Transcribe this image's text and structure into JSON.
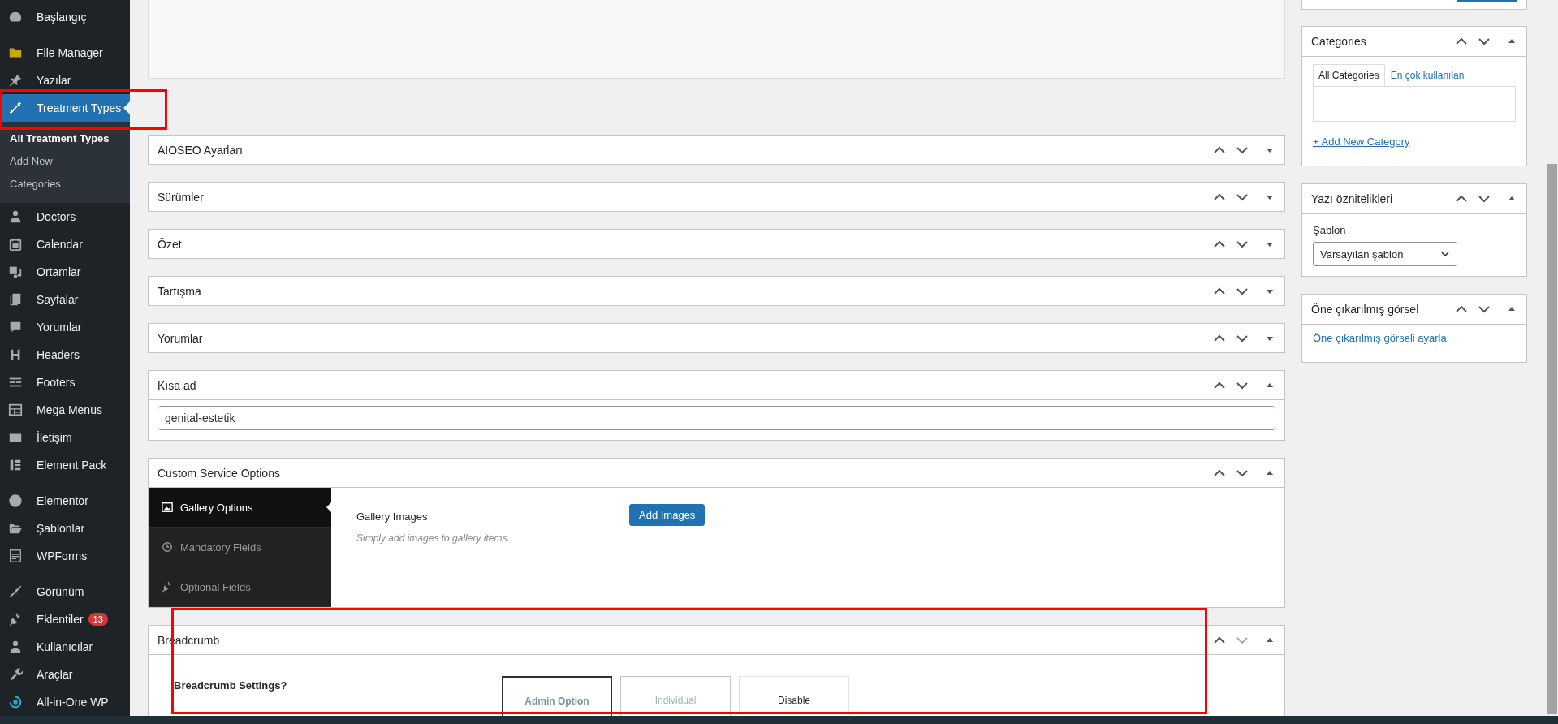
{
  "sidebar": {
    "groups": [
      [
        {
          "label": "Başlangıç",
          "selected": false
        }
      ],
      [
        {
          "label": "File Manager",
          "selected": false
        },
        {
          "label": "Yazılar",
          "selected": false
        },
        {
          "label": "Treatment Types",
          "selected": true,
          "annotated": true,
          "children": [
            {
              "label": "All Treatment Types",
              "selected": true
            },
            {
              "label": "Add New",
              "selected": false
            },
            {
              "label": "Categories",
              "selected": false
            }
          ]
        },
        {
          "label": "Doctors",
          "selected": false
        },
        {
          "label": "Calendar",
          "selected": false
        },
        {
          "label": "Ortamlar",
          "selected": false
        },
        {
          "label": "Sayfalar",
          "selected": false
        },
        {
          "label": "Yorumlar",
          "selected": false
        },
        {
          "label": "Headers",
          "selected": false
        },
        {
          "label": "Footers",
          "selected": false
        },
        {
          "label": "Mega Menus",
          "selected": false
        },
        {
          "label": "İletişim",
          "selected": false
        },
        {
          "label": "Element Pack",
          "selected": false
        }
      ],
      [
        {
          "label": "Elementor",
          "selected": false
        },
        {
          "label": "Şablonlar",
          "selected": false
        },
        {
          "label": "WPForms",
          "selected": false
        }
      ],
      [
        {
          "label": "Görünüm",
          "selected": false
        },
        {
          "label": "Eklentiler",
          "selected": false,
          "badge": "13"
        },
        {
          "label": "Kullanıcılar",
          "selected": false
        },
        {
          "label": "Araçlar",
          "selected": false
        },
        {
          "label": "All-in-One WP",
          "selected": false
        }
      ]
    ]
  },
  "main": {
    "panels": [
      {
        "title": "AIOSEO Ayarları",
        "expanded": false
      },
      {
        "title": "Sürümler",
        "expanded": false
      },
      {
        "title": "Özet",
        "expanded": false
      },
      {
        "title": "Tartışma",
        "expanded": false
      },
      {
        "title": "Yorumlar",
        "expanded": false
      },
      {
        "title": "Kısa ad",
        "kind": "slug",
        "expanded": true,
        "value": "genital-estetik"
      },
      {
        "title": "Custom Service Options",
        "kind": "tabs",
        "expanded": true,
        "tabs": [
          {
            "label": "Gallery Options",
            "selected": true
          },
          {
            "label": "Mandatory Fields",
            "selected": false
          },
          {
            "label": "Optional Fields",
            "selected": false
          }
        ],
        "field": {
          "label": "Gallery Images",
          "description": "Simply add images to gallery items.",
          "button": "Add Images"
        }
      },
      {
        "title": "Breadcrumb",
        "kind": "choice",
        "expanded": true,
        "annotated": true,
        "label": "Breadcrumb Settings?",
        "options": [
          {
            "label": "Admin Option",
            "selected": true
          },
          {
            "label": "Individual",
            "selected": false
          },
          {
            "label": "Disable",
            "selected": false
          }
        ]
      }
    ]
  },
  "side_panels": [
    {
      "title": "Categories",
      "kind": "categories",
      "expanded": true,
      "tabs": [
        {
          "label": "All Categories",
          "selected": true
        },
        {
          "label": "En çok kullanılan",
          "selected": false
        }
      ],
      "link": "+ Add New Category"
    },
    {
      "title": "Yazı öznitelikleri",
      "kind": "attributes",
      "expanded": true,
      "label": "Şablon",
      "value": "Varsayılan şablon"
    },
    {
      "title": "Öne çıkarılmış görsel",
      "kind": "featured",
      "expanded": true,
      "link": "Öne çıkarılmış görseli ayarla"
    }
  ]
}
